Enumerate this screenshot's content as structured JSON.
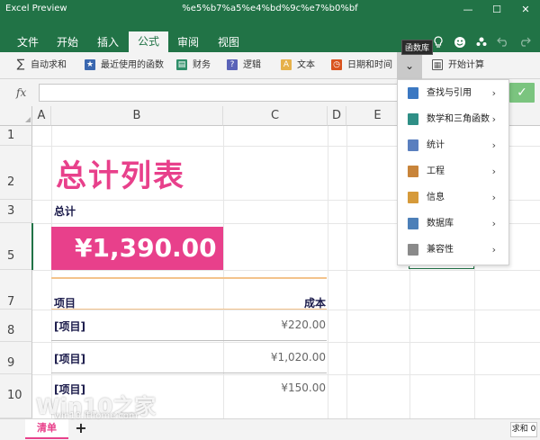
{
  "window": {
    "app_title": "Excel Preview",
    "doc_title": "%e5%b7%a5%e4%bd%9c%e7%b0%bf",
    "minimize": "—",
    "maximize": "☐",
    "close": "✕"
  },
  "tabs": [
    "文件",
    "开始",
    "插入",
    "公式",
    "审阅",
    "视图"
  ],
  "active_tab": "公式",
  "tooltip": "函数库",
  "top_icons": [
    "lightbulb-icon",
    "smiley-icon",
    "people-icon",
    "undo-icon",
    "redo-icon"
  ],
  "ribbon": {
    "autosum": "自动求和",
    "recent": "最近使用的函数",
    "financial": "财务",
    "logical": "逻辑",
    "text": "文本",
    "datetime": "日期和时间",
    "more_chevron": "⌄",
    "calculate": "开始计算"
  },
  "formula_bar": {
    "fx": "fx",
    "value": "",
    "confirm": "✓"
  },
  "columns": [
    "A",
    "B",
    "C",
    "D",
    "E"
  ],
  "rows": [
    "1",
    "2",
    "3",
    "5",
    "7",
    "8",
    "9",
    "10"
  ],
  "sheet": {
    "title": "总计列表",
    "total_label": "总计",
    "total_value": "¥1,390.00",
    "header_item": "项目",
    "header_cost": "成本",
    "items": [
      {
        "name": "[项目]",
        "cost": "¥220.00"
      },
      {
        "name": "[项目]",
        "cost": "¥1,020.00"
      },
      {
        "name": "[项目]",
        "cost": "¥150.00"
      }
    ]
  },
  "dropdown": {
    "items": [
      {
        "label": "查找与引用",
        "color": "#3b78c2"
      },
      {
        "label": "数学和三角函数",
        "color": "#2f8f86"
      },
      {
        "label": "统计",
        "color": "#5a7fbf"
      },
      {
        "label": "工程",
        "color": "#c8843a"
      },
      {
        "label": "信息",
        "color": "#d69a3a"
      },
      {
        "label": "数据库",
        "color": "#4c7fb8"
      },
      {
        "label": "兼容性",
        "color": "#8a8a8a"
      }
    ],
    "chevron": "›"
  },
  "bottom": {
    "sheet_tab": "清单",
    "add": "+",
    "sum_label": "求和",
    "sum_value": "0"
  },
  "watermark": {
    "logo": "Win10之家",
    "url": "win10.ithome.com"
  }
}
